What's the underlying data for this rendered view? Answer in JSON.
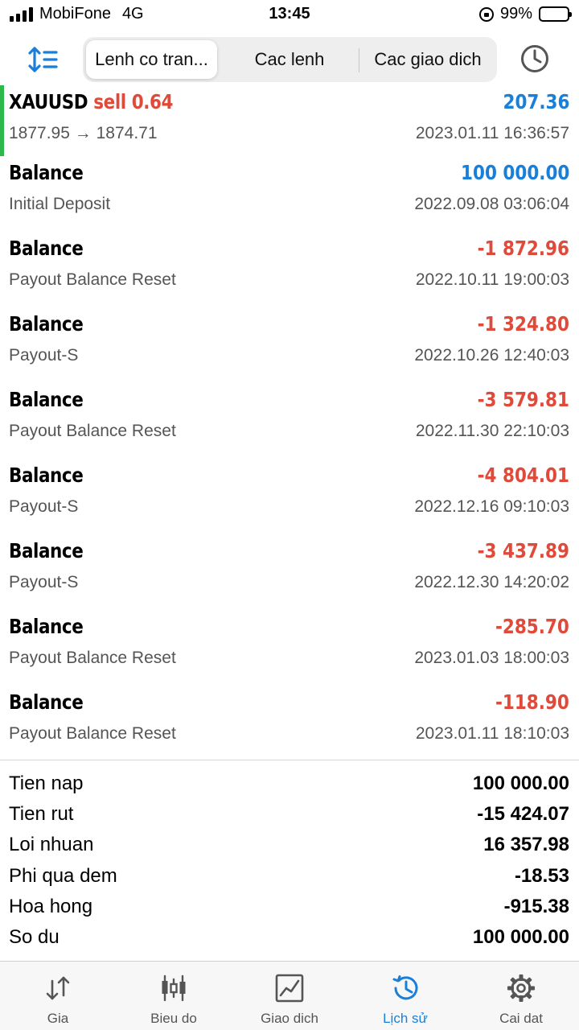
{
  "status_bar": {
    "carrier": "MobiFone",
    "network": "4G",
    "time": "13:45",
    "battery": "99%"
  },
  "toolbar": {
    "segments": [
      {
        "label": "Lenh co tran...",
        "active": true
      },
      {
        "label": "Cac lenh",
        "active": false
      },
      {
        "label": "Cac giao dich",
        "active": false
      }
    ],
    "sort_icon": "sort-arrows-icon",
    "clock_icon": "clock-icon"
  },
  "position": {
    "symbol": "XAUUSD",
    "side": "sell 0.64",
    "price_open": "1877.95",
    "price_close": "1874.71",
    "price_arrow": "→",
    "profit": "207.36",
    "datetime": "2023.01.11 16:36:57"
  },
  "deals": [
    {
      "title": "Balance",
      "comment": "Initial Deposit",
      "amount": "100 000.00",
      "color": "blue",
      "datetime": "2022.09.08 03:06:04"
    },
    {
      "title": "Balance",
      "comment": "Payout Balance Reset",
      "amount": "-1 872.96",
      "color": "red",
      "datetime": "2022.10.11 19:00:03"
    },
    {
      "title": "Balance",
      "comment": "Payout-S",
      "amount": "-1 324.80",
      "color": "red",
      "datetime": "2022.10.26 12:40:03"
    },
    {
      "title": "Balance",
      "comment": "Payout Balance Reset",
      "amount": "-3 579.81",
      "color": "red",
      "datetime": "2022.11.30 22:10:03"
    },
    {
      "title": "Balance",
      "comment": "Payout-S",
      "amount": "-4 804.01",
      "color": "red",
      "datetime": "2022.12.16 09:10:03"
    },
    {
      "title": "Balance",
      "comment": "Payout-S",
      "amount": "-3 437.89",
      "color": "red",
      "datetime": "2022.12.30 14:20:02"
    },
    {
      "title": "Balance",
      "comment": "Payout Balance Reset",
      "amount": "-285.70",
      "color": "red",
      "datetime": "2023.01.03 18:00:03"
    },
    {
      "title": "Balance",
      "comment": "Payout Balance Reset",
      "amount": "-118.90",
      "color": "red",
      "datetime": "2023.01.11 18:10:03"
    }
  ],
  "summary": [
    {
      "label": "Tien nap",
      "value": "100 000.00"
    },
    {
      "label": "Tien rut",
      "value": "-15 424.07"
    },
    {
      "label": "Loi nhuan",
      "value": "16 357.98"
    },
    {
      "label": "Phi qua dem",
      "value": "-18.53"
    },
    {
      "label": "Hoa hong",
      "value": "-915.38"
    },
    {
      "label": "So du",
      "value": "100 000.00"
    }
  ],
  "tabs": [
    {
      "label": "Gia",
      "icon": "quotes-arrows-icon",
      "active": false
    },
    {
      "label": "Bieu do",
      "icon": "candlestick-chart-icon",
      "active": false
    },
    {
      "label": "Giao dich",
      "icon": "trade-chart-icon",
      "active": false
    },
    {
      "label": "Lịch sử",
      "icon": "history-icon",
      "active": true
    },
    {
      "label": "Cai dat",
      "icon": "settings-gear-icon",
      "active": false
    }
  ],
  "colors": {
    "accent_blue": "#1a7fd8",
    "negative_red": "#e04a3a",
    "position_green": "#2db84c"
  }
}
